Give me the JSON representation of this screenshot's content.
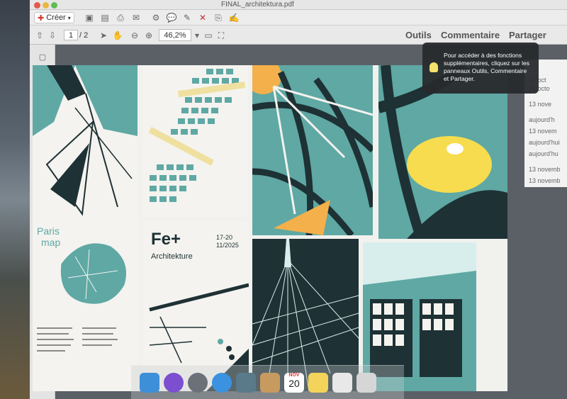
{
  "window": {
    "title": "FINAL_architektura.pdf"
  },
  "toolbar": {
    "create_label": "Créer",
    "page_current": "1",
    "page_total": "/ 2",
    "zoom": "46,2%"
  },
  "right_tabs": {
    "tools": "Outils",
    "comment": "Commentaire",
    "share": "Partager"
  },
  "tooltip": {
    "text": "Pour accéder à des fonctions supplémentaires, cliquez sur les panneaux Outils, Commentaire et Partager."
  },
  "dates": [
    "27 oct",
    "27 octo",
    "13 nove",
    "aujourd'h",
    "13 novem",
    "aujourd'hui",
    "aujourd'hu",
    "13 novemb",
    "13 novemb"
  ],
  "document": {
    "paris_title": "Paris",
    "paris_subtitle": "map",
    "fe_title": "Fe+",
    "fe_subtitle": "Architekture",
    "fe_dates": "17-20 11/2025"
  },
  "dock": {
    "calendar_month": "NOV",
    "calendar_day": "20"
  },
  "colors": {
    "teal": "#5fa8a4",
    "dark": "#1e3135",
    "yellow": "#f6dc4e",
    "orange": "#f4b04a"
  }
}
